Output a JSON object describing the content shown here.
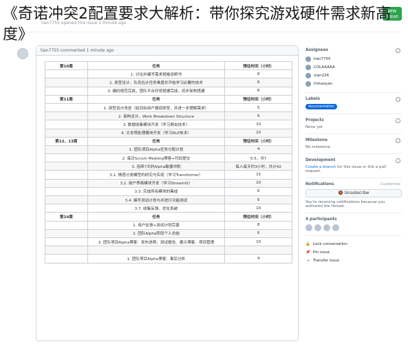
{
  "overlay_title": "《奇诺冲突2配置要求大解析：带你探究游戏硬件需求新高度》",
  "header": {
    "meta": "tian7755 opened this issue 1 minute ago",
    "new_issue_button": "New issue"
  },
  "comment": {
    "meta": "tian7755 commented 1 minute ago",
    "table": {
      "rows": [
        {
          "week": "第10周",
          "task": "任务",
          "hours": "预估时间（小时）",
          "header": true
        },
        {
          "week": "",
          "task": "1. 讨论并编写需求规格说明书",
          "hours": "8"
        },
        {
          "week": "",
          "task": "2. 原型设计，队员估计任务难度并开始学习必要的技术",
          "hours": "8"
        },
        {
          "week": "",
          "task": "3. 编码规范完成，团队平台环境搭建完成，初步架构搭建",
          "hours": "8"
        },
        {
          "week": "第11周",
          "task": "任务",
          "hours": "预估时间（小时）",
          "header": true
        },
        {
          "week": "",
          "task": "1. 原型设计改进（给目标用户展现原型，并进一步理解需求）",
          "hours": "5"
        },
        {
          "week": "",
          "task": "2. 架构设计，Work Breakdown Structure",
          "hours": "6"
        },
        {
          "week": "",
          "task": "3. 数据收集模块开发（学习爬虫技术）",
          "hours": "10"
        },
        {
          "week": "",
          "task": "4. 文本预处理模块开发（学习NLP技术）",
          "hours": "10"
        },
        {
          "week": "第12、13周",
          "task": "任务",
          "hours": "预估时间（小时）",
          "header": true
        },
        {
          "week": "",
          "task": "1. 团队项目Alpha任务分配计划",
          "hours": "4"
        },
        {
          "week": "",
          "task": "2. 每日Scrum Meeting博客+代码提交",
          "hours": "0.5，共7"
        },
        {
          "week": "",
          "task": "3. 连续7天的Alpha敏捷冲刺",
          "hours": "每人每天约3小时，共计42"
        },
        {
          "week": "",
          "task": "3.1. 情感分类模型的研究与实现（学习Transformer）",
          "hours": "15"
        },
        {
          "week": "",
          "task": "3.2. 用户界面模块开发（学习Streamlit）",
          "hours": "10"
        },
        {
          "week": "",
          "task": "3.3. 完成所有模块的集成",
          "hours": "6"
        },
        {
          "week": "",
          "task": "3.4. 编写测试计划与并进行功能测试",
          "hours": "6"
        },
        {
          "week": "",
          "task": "3.7. 收集反馈、优化系统",
          "hours": "10"
        },
        {
          "week": "第14周",
          "task": "任务",
          "hours": "预估时间（小时）",
          "header": true
        },
        {
          "week": "",
          "task": "1. 用户反馈+测试计划完善",
          "hours": "8"
        },
        {
          "week": "",
          "task": "2. 团队Alpha阶段个人总结",
          "hours": "6"
        },
        {
          "week": "",
          "task": "3. 团队项目Alpha博客：发布说明、测试报告、展示博客、项目管理",
          "hours": "10"
        },
        {
          "week": "",
          "task": "",
          "hours": ""
        },
        {
          "week": "",
          "task": "1. 团队项目Alpha博客：事后分析",
          "hours": "4"
        }
      ]
    }
  },
  "sidebar": {
    "assignees": {
      "title": "Assignees",
      "people": [
        "tian7755",
        "COLAAAAA",
        "xian226",
        "hhhaoyan"
      ]
    },
    "labels": {
      "title": "Labels",
      "items": [
        "documentation"
      ]
    },
    "projects": {
      "title": "Projects",
      "value": "None yet"
    },
    "milestone": {
      "title": "Milestone",
      "value": "No milestone"
    },
    "development": {
      "title": "Development",
      "link_text": "Create a branch",
      "rest_text": " for this issue or link a pull request."
    },
    "notifications": {
      "title": "Notifications",
      "customize": "Customize",
      "unsubscribe": "Unsubscribe",
      "note": "You're receiving notifications because you authored the thread."
    },
    "participants": {
      "title": "4 participants",
      "count": 4
    },
    "actions": {
      "lock": "Lock conversation",
      "pin": "Pin issue",
      "transfer": "Transfer issue"
    }
  }
}
